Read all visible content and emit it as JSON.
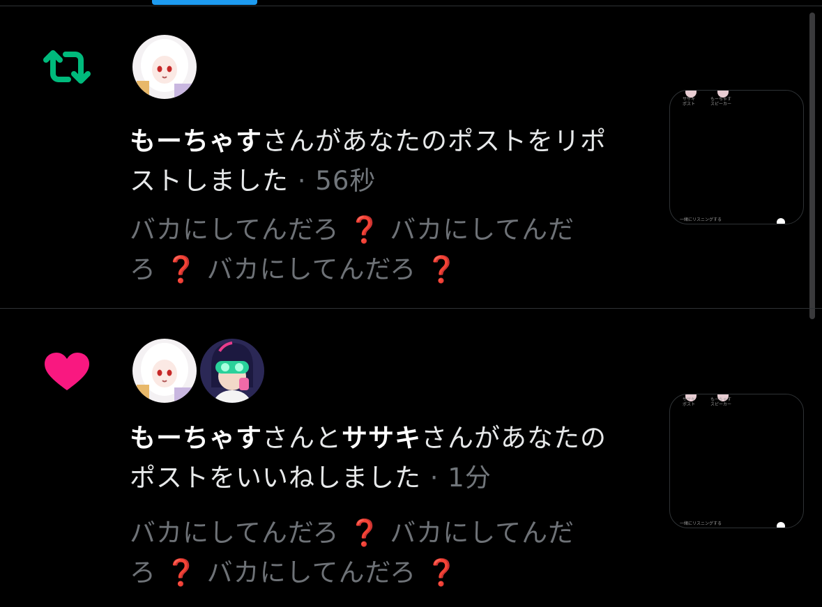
{
  "tabs": {
    "active_indicator_color": "#1d9bf0"
  },
  "notifications": [
    {
      "type": "repost",
      "icon": "repost-icon",
      "icon_color": "#00ba7c",
      "user1": "もーちゃす",
      "text_a": "さんがあなたのポストをリポストしました",
      "time": "· 56秒",
      "snippet": {
        "line1_a": "バカにしてんだろ",
        "q": "❓",
        "line1_b": "バカにしてんだ",
        "line2_a": "ろ",
        "line2_b": "バカにしてんだろ"
      },
      "thumb": {
        "label_tl": "ササキ",
        "label_tl2": "ポスト",
        "label_tr": "もーちゃす",
        "label_tr2": "スピーカー",
        "label_bottom": "一緒にリスニングする"
      }
    },
    {
      "type": "like",
      "icon": "heart-icon",
      "icon_color": "#f91880",
      "user1": "もーちゃす",
      "text_mid": "さんと",
      "user2": "ササキ",
      "text_a": "さんがあなたのポストをいいねしました",
      "time": "· 1分",
      "snippet": {
        "line1_a": "バカにしてんだろ",
        "q": "❓",
        "line1_b": "バカにしてんだ",
        "line2_a": "ろ",
        "line2_b": "バカにしてんだろ"
      },
      "thumb": {
        "label_tl": "ササキ",
        "label_tl2": "ポスト",
        "label_tr": "もーちゃす",
        "label_tr2": "スピーカー",
        "label_bottom": "一緒にリスニングする"
      }
    }
  ]
}
